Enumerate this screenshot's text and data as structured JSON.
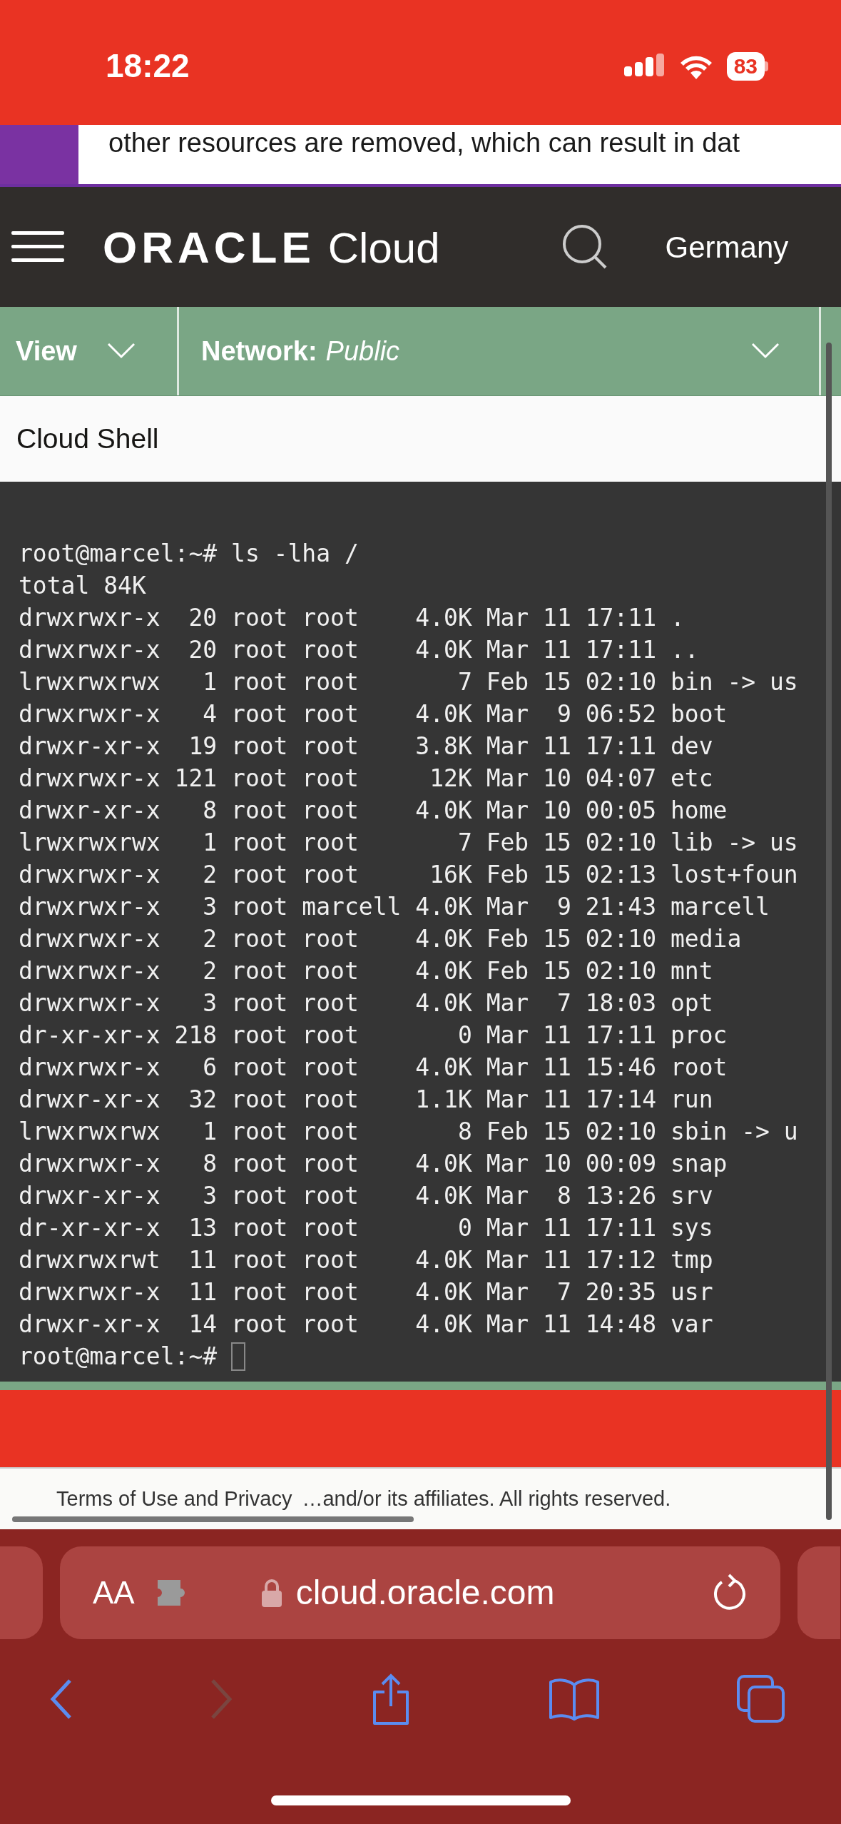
{
  "status_bar": {
    "time": "18:22",
    "battery": "83"
  },
  "banner": {
    "text": "other resources are removed, which can result in dat"
  },
  "header": {
    "logo": "ORACLE",
    "product": "Cloud",
    "region": "Germany"
  },
  "toolbar": {
    "view": "View",
    "network_label": "Network:",
    "network_value": "Public"
  },
  "panel_title": "Cloud Shell",
  "terminal": {
    "lines": [
      "root@marcel:~# ls -lha /",
      "total 84K",
      "drwxrwxr-x  20 root root    4.0K Mar 11 17:11 .",
      "drwxrwxr-x  20 root root    4.0K Mar 11 17:11 ..",
      "lrwxrwxrwx   1 root root       7 Feb 15 02:10 bin -> us",
      "drwxrwxr-x   4 root root    4.0K Mar  9 06:52 boot",
      "drwxr-xr-x  19 root root    3.8K Mar 11 17:11 dev",
      "drwxrwxr-x 121 root root     12K Mar 10 04:07 etc",
      "drwxr-xr-x   8 root root    4.0K Mar 10 00:05 home",
      "lrwxrwxrwx   1 root root       7 Feb 15 02:10 lib -> us",
      "drwxrwxr-x   2 root root     16K Feb 15 02:13 lost+foun",
      "drwxrwxr-x   3 root marcell 4.0K Mar  9 21:43 marcell",
      "drwxrwxr-x   2 root root    4.0K Feb 15 02:10 media",
      "drwxrwxr-x   2 root root    4.0K Feb 15 02:10 mnt",
      "drwxrwxr-x   3 root root    4.0K Mar  7 18:03 opt",
      "dr-xr-xr-x 218 root root       0 Mar 11 17:11 proc",
      "drwxrwxr-x   6 root root    4.0K Mar 11 15:46 root",
      "drwxr-xr-x  32 root root    1.1K Mar 11 17:14 run",
      "lrwxrwxrwx   1 root root       8 Feb 15 02:10 sbin -> u",
      "drwxrwxr-x   8 root root    4.0K Mar 10 00:09 snap",
      "drwxr-xr-x   3 root root    4.0K Mar  8 13:26 srv",
      "dr-xr-xr-x  13 root root       0 Mar 11 17:11 sys",
      "drwxrwxrwt  11 root root    4.0K Mar 11 17:12 tmp",
      "drwxrwxr-x  11 root root    4.0K Mar  7 20:35 usr",
      "drwxr-xr-x  14 root root    4.0K Mar 11 14:48 var"
    ],
    "prompt": "root@marcel:~#"
  },
  "footer": {
    "left": "Terms of Use and Privacy",
    "right": "…and/or its affiliates. All rights reserved."
  },
  "browser": {
    "text_size": "AA",
    "url": "cloud.oracle.com"
  }
}
